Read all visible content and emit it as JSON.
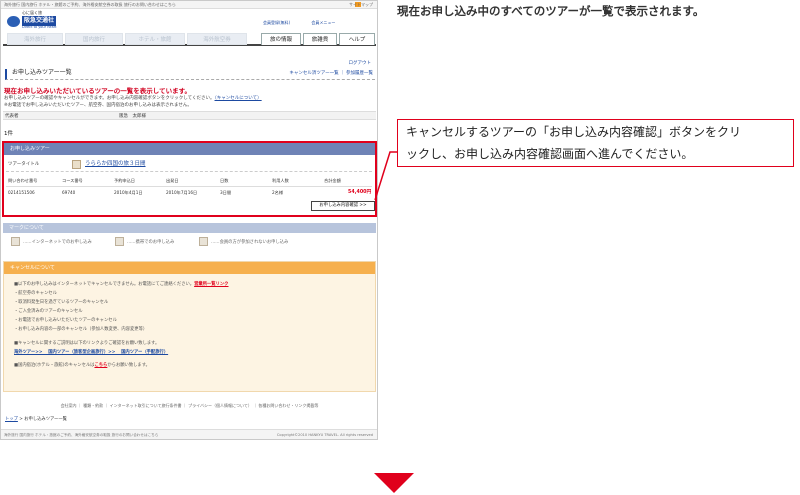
{
  "caption": "現在お申し込み中のすべてのツアーが一覧で表示されます。",
  "callout": {
    "line1": "キャンセルするツアーの「お申し込み内容確認」ボタンをクリ",
    "line2": "ックし、お申し込み内容確認画面へ進んでください。"
  },
  "shot": {
    "topbar_text": "海外旅行 国内旅行 ホテル・旅館のご予約、海外格安航空券の取扱 旅行のお問い合わせはこちら",
    "sitemap": "サイトマップ",
    "logo": {
      "slogan": "心に届く旅",
      "name": "阪急交通社",
      "en": "Direct to your heart"
    },
    "userlinks": [
      "会員登録(無料)",
      "会員メニュー"
    ],
    "tabs": [
      "海外旅行",
      "国内旅行",
      "ホテル・旅館",
      "海外航空券",
      "旅の情報",
      "旅雑貨",
      "ヘルプ"
    ],
    "logout": "ログアウト",
    "page_title": "お申し込みツアー一覧",
    "page_links": "キャンセル済ツアー一覧 ｜ 参加履歴一覧",
    "headline": "現在お申し込みいただいているツアーの一覧を表示しています。",
    "note1": "お申し込みツアーの確認やキャンセルができます。お申し込み内容確認ボタンをクリックしてください。",
    "note1_link": "（キャンセルについて）",
    "note2": "※お電話でお申し込みいただいたツアー、航空券、国内宿泊のお申し込みは表示されません。",
    "rep": {
      "label": "代表者",
      "value": "阪急　太郎様"
    },
    "count": "1件",
    "tour": {
      "head": "お申し込みツアー",
      "title_label": "ツアータイトル",
      "title": "うららか四国の旅３日間",
      "headers": [
        "問い合わせ番号",
        "コース番号",
        "予約申込日",
        "出発日",
        "日数",
        "利用人数",
        "合計金額"
      ],
      "values": [
        "0214151506",
        "69740",
        "2010年4月1日",
        "2010年7月16日",
        "3日間",
        "2名様",
        "54,400円"
      ],
      "confirm": "お申し込み内容確認 >>"
    },
    "mark": {
      "head": "マークについて",
      "items": [
        "……インターネットでのお申し込み",
        "……携帯でのお申し込み",
        "……会員の方が参加されないお申し込み"
      ]
    },
    "cancel": {
      "head": "キャンセルについて",
      "lines": [
        "■以下のお申し込みはインターネットでキャンセルできません。お電話にてご連絡ください。",
        "・航空券のキャンセル",
        "・取消料発生日を過ぎているツアーのキャンセル",
        "・ご入金済みのツアーのキャンセル",
        "・お電話でお申し込みいただいたツアーのキャンセル",
        "・お申し込み内容の一部のキャンセル（参加人数変更、内容変更等）",
        "■キャンセルに関するご説明は以下のリンクよりご確認をお願い致します。",
        "■国内宿泊(ホテル・旅館)のキャンセルは"
      ],
      "branch_link": "営業所一覧リンク",
      "links_row": "海外ツアー>>　 国内ツアー（旅客型企画旅行）>>　 国内ツアー（手配旅行）",
      "here": "こちら",
      "here_tail": "からお願い致します。"
    },
    "footer": "会社案内 ｜ 種類・約款 ｜ インターネット取引について旅行条件書 ｜ プライバシー（個人情報について） ｜ 各種お問い合わせ・リンク掲載等",
    "crumb_link": "トップ",
    "crumb_rest": " > お申し込みツアー一覧",
    "bottom_text": "海外旅行 国内旅行 ホテル・旅館のご予約、海外格安航空券の取扱 旅行のお問い合わせはこちら",
    "copyright": "Copyright©2010 HANKYU TRAVEL. All rights reserved"
  },
  "colors": {
    "accent_red": "#e0001c",
    "brand_blue": "#1d4aa1"
  }
}
